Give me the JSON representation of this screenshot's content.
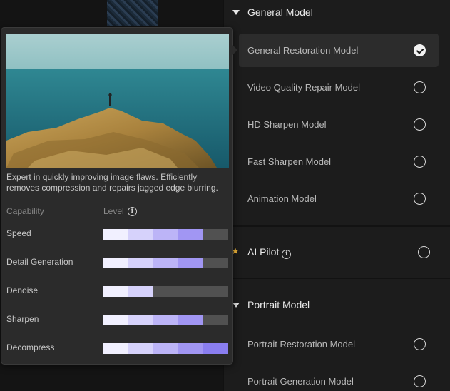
{
  "sections": {
    "general": {
      "title": "General Model",
      "items": [
        {
          "label": "General Restoration Model",
          "selected": true
        },
        {
          "label": "Video Quality Repair Model",
          "selected": false
        },
        {
          "label": "HD Sharpen Model",
          "selected": false
        },
        {
          "label": "Fast Sharpen Model",
          "selected": false
        },
        {
          "label": "Animation Model",
          "selected": false
        }
      ]
    },
    "pilot": {
      "label": "AI Pilot",
      "selected": false
    },
    "portrait": {
      "title": "Portrait Model",
      "items": [
        {
          "label": "Portrait Restoration Model",
          "selected": false
        },
        {
          "label": "Portrait Generation Model",
          "selected": false
        }
      ]
    }
  },
  "tooltip": {
    "description": "Expert in quickly improving image flaws. Efficiently removes compression and repairs jagged edge blurring.",
    "capability_header": "Capability",
    "level_header": "Level",
    "max_level": 5,
    "capabilities": [
      {
        "name": "Speed",
        "level": 4
      },
      {
        "name": "Detail Generation",
        "level": 4
      },
      {
        "name": "Denoise",
        "level": 2
      },
      {
        "name": "Sharpen",
        "level": 4
      },
      {
        "name": "Decompress",
        "level": 5
      }
    ],
    "level_colors": [
      "#f1f0ff",
      "#d6d2fb",
      "#bcb4f7",
      "#a196f3",
      "#8a7ef0"
    ],
    "empty_color": "#515151"
  },
  "icons": {
    "expand": "triangle-down-icon",
    "check": "check-circle-icon",
    "radio": "radio-empty-icon",
    "star": "star-icon",
    "info": "info-icon",
    "trash": "trash-icon"
  }
}
